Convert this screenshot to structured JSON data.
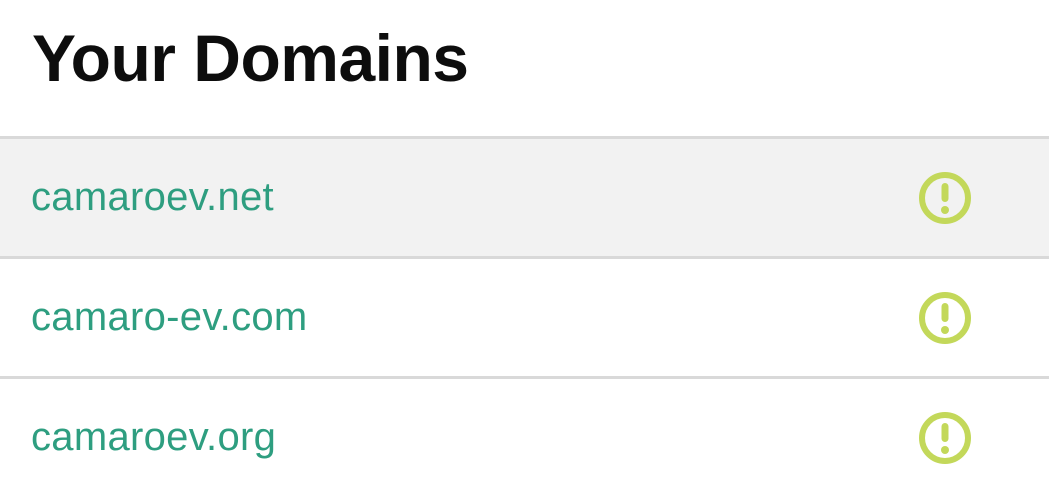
{
  "page": {
    "title": "Your Domains"
  },
  "colors": {
    "link": "#2e9e80",
    "warning": "#c3d85a",
    "highlight_row": "#f2f2f2",
    "divider": "#d9d9d9"
  },
  "domains": [
    {
      "name": "camaroev.net",
      "status_icon": "warning-icon",
      "highlighted": true
    },
    {
      "name": "camaro-ev.com",
      "status_icon": "warning-icon",
      "highlighted": false
    },
    {
      "name": "camaroev.org",
      "status_icon": "warning-icon",
      "highlighted": false
    }
  ]
}
